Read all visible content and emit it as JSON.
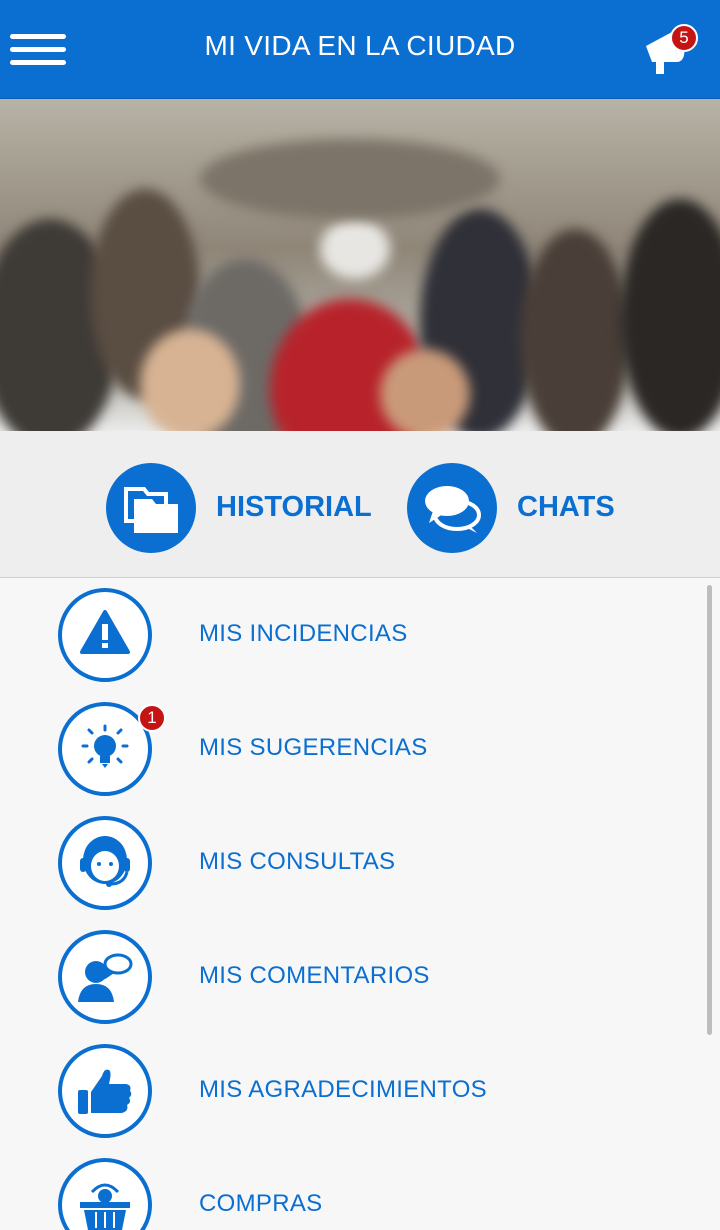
{
  "header": {
    "title": "MI VIDA EN LA CIUDAD",
    "notification_count": "5"
  },
  "quick_actions": [
    {
      "label": "HISTORIAL",
      "icon": "folder-icon"
    },
    {
      "label": "CHATS",
      "icon": "chat-bubbles-icon"
    }
  ],
  "menu": {
    "items": [
      {
        "label": "MIS INCIDENCIAS",
        "icon": "warning-icon"
      },
      {
        "label": "MIS SUGERENCIAS",
        "icon": "lightbulb-icon",
        "badge": "1"
      },
      {
        "label": "MIS CONSULTAS",
        "icon": "headset-operator-icon"
      },
      {
        "label": "MIS COMENTARIOS",
        "icon": "person-speech-icon"
      },
      {
        "label": "MIS AGRADECIMIENTOS",
        "icon": "thumbs-up-icon"
      },
      {
        "label": "COMPRAS",
        "icon": "shopping-basket-icon"
      }
    ]
  },
  "colors": {
    "primary": "#0a6fd1",
    "badge": "#c41414",
    "background": "#f7f7f7"
  }
}
